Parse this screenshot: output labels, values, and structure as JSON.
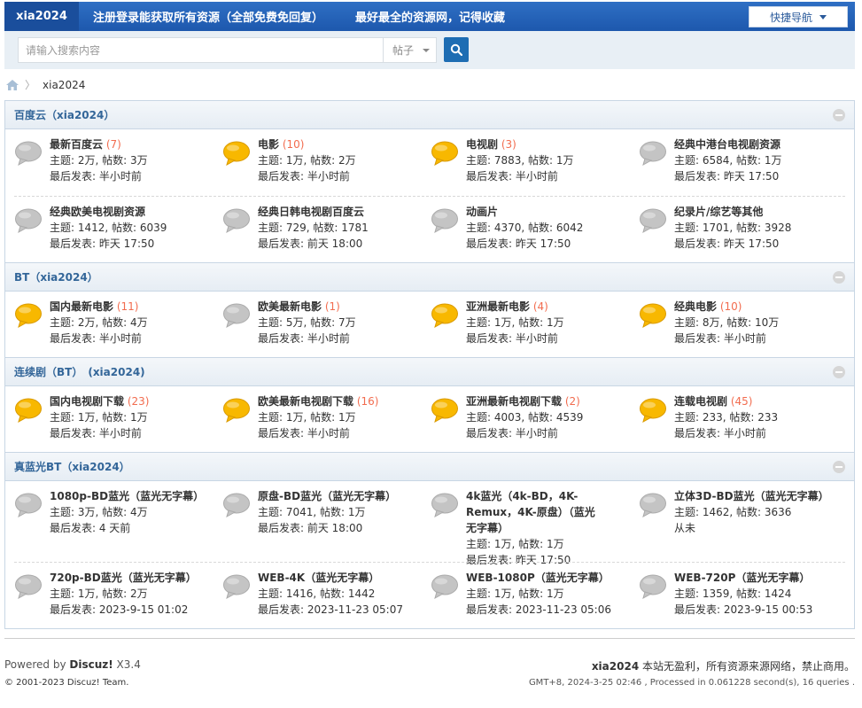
{
  "topnav": {
    "brand": "xia2024",
    "link1": "注册登录能获取所有资源（全部免费免回复）",
    "link2": "最好最全的资源网，记得收藏",
    "quicknav": "快捷导航"
  },
  "search": {
    "placeholder": "请输入搜索内容",
    "type": "帖子"
  },
  "breadcrumb": {
    "current": "xia2024"
  },
  "sections": [
    {
      "title": "百度云（xia2024）",
      "rows": [
        [
          {
            "name": "最新百度云",
            "count": "(7)",
            "topics": "主题: 2万, 帖数: 3万",
            "last": "最后发表: 半小时前",
            "new": false
          },
          {
            "name": "电影",
            "count": "(10)",
            "topics": "主题: 1万, 帖数: 2万",
            "last": "最后发表: 半小时前",
            "new": true
          },
          {
            "name": "电视剧",
            "count": "(3)",
            "topics": "主题: 7883, 帖数: 1万",
            "last": "最后发表: 半小时前",
            "new": true
          },
          {
            "name": "经典中港台电视剧资源",
            "count": "",
            "topics": "主题: 6584, 帖数: 1万",
            "last": "最后发表: 昨天 17:50",
            "new": false
          }
        ],
        [
          {
            "name": "经典欧美电视剧资源",
            "count": "",
            "topics": "主题: 1412, 帖数: 6039",
            "last": "最后发表: 昨天 17:50",
            "new": false
          },
          {
            "name": "经典日韩电视剧百度云",
            "count": "",
            "topics": "主题: 729, 帖数: 1781",
            "last": "最后发表: 前天 18:00",
            "new": false
          },
          {
            "name": "动画片",
            "count": "",
            "topics": "主题: 4370, 帖数: 6042",
            "last": "最后发表: 昨天 17:50",
            "new": false
          },
          {
            "name": "纪录片/综艺等其他",
            "count": "",
            "topics": "主题: 1701, 帖数: 3928",
            "last": "最后发表: 昨天 17:50",
            "new": false
          }
        ]
      ]
    },
    {
      "title": "BT（xia2024）",
      "rows": [
        [
          {
            "name": "国内最新电影",
            "count": "(11)",
            "topics": "主题: 2万, 帖数: 4万",
            "last": "最后发表: 半小时前",
            "new": true
          },
          {
            "name": "欧美最新电影",
            "count": "(1)",
            "topics": "主题: 5万, 帖数: 7万",
            "last": "最后发表: 半小时前",
            "new": false
          },
          {
            "name": "亚洲最新电影",
            "count": "(4)",
            "topics": "主题: 1万, 帖数: 1万",
            "last": "最后发表: 半小时前",
            "new": true
          },
          {
            "name": "经典电影",
            "count": "(10)",
            "topics": "主题: 8万, 帖数: 10万",
            "last": "最后发表: 半小时前",
            "new": true
          }
        ]
      ]
    },
    {
      "title": "连续剧（BT）　(xia2024)",
      "rows": [
        [
          {
            "name": "国内电视剧下载",
            "count": "(23)",
            "topics": "主题: 1万, 帖数: 1万",
            "last": "最后发表: 半小时前",
            "new": true
          },
          {
            "name": "欧美最新电视剧下载",
            "count": "(16)",
            "topics": "主题: 1万, 帖数: 1万",
            "last": "最后发表: 半小时前",
            "new": true
          },
          {
            "name": "亚洲最新电视剧下载",
            "count": "(2)",
            "topics": "主题: 4003, 帖数: 4539",
            "last": "最后发表: 半小时前",
            "new": true
          },
          {
            "name": "连载电视剧",
            "count": "(45)",
            "topics": "主题: 233, 帖数: 233",
            "last": "最后发表: 半小时前",
            "new": true
          }
        ]
      ]
    },
    {
      "title": "真蓝光BT（xia2024）",
      "rows": [
        [
          {
            "name": "1080p-BD蓝光（蓝光无字幕）",
            "count": "",
            "topics": "主题: 3万, 帖数: 4万",
            "last": "最后发表: 4 天前",
            "new": false
          },
          {
            "name": "原盘-BD蓝光（蓝光无字幕）",
            "count": "",
            "topics": "主题: 7041, 帖数: 1万",
            "last": "最后发表: 前天 18:00",
            "new": false
          },
          {
            "name": "4k蓝光（4k-BD，4K-Remux，4K-原盘）（蓝光无字幕）",
            "count": "",
            "topics": "主题: 1万, 帖数: 1万",
            "last": "最后发表: 昨天 17:50",
            "new": false
          },
          {
            "name": "立体3D-BD蓝光（蓝光无字幕）",
            "count": "",
            "topics": "主题: 1462, 帖数: 3636",
            "last": "从未",
            "new": false
          }
        ],
        [
          {
            "name": "720p-BD蓝光（蓝光无字幕）",
            "count": "",
            "topics": "主题: 1万, 帖数: 2万",
            "last": "最后发表: 2023-9-15 01:02",
            "new": false
          },
          {
            "name": "WEB-4K（蓝光无字幕）",
            "count": "",
            "topics": "主题: 1416, 帖数: 1442",
            "last": "最后发表: 2023-11-23 05:07",
            "new": false
          },
          {
            "name": "WEB-1080P（蓝光无字幕）",
            "count": "",
            "topics": "主题: 1万, 帖数: 1万",
            "last": "最后发表: 2023-11-23 05:06",
            "new": false
          },
          {
            "name": "WEB-720P（蓝光无字幕）",
            "count": "",
            "topics": "主题: 1359, 帖数: 1424",
            "last": "最后发表: 2023-9-15 00:53",
            "new": false
          }
        ]
      ]
    }
  ],
  "footer": {
    "powered_prefix": "Powered by ",
    "powered_brand": "Discuz!",
    "powered_version": " X3.4",
    "copyright": "© 2001-2023 Discuz! Team.",
    "site_name": "xia2024",
    "disclaimer": " 本站无盈利，所有资源来源网络，禁止商用。",
    "stats": "GMT+8, 2024-3-25 02:46 , Processed in 0.061228 second(s), 16 queries ."
  },
  "colors": {
    "nav": "#1d58ad",
    "brand_bg": "#1a4e9c",
    "section_title": "#336699",
    "count": "#f26c4f",
    "icon_new": "#f8b800",
    "icon_old": "#c4c4c4"
  }
}
